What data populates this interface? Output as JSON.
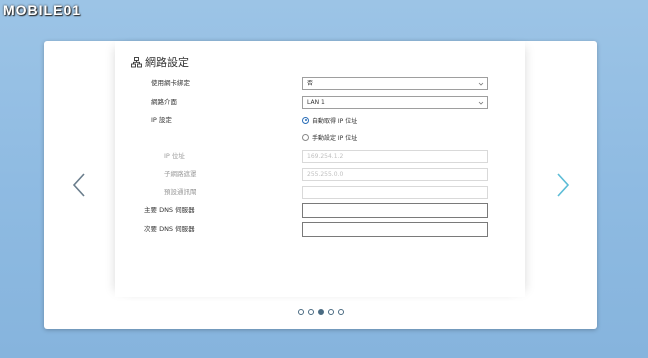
{
  "watermark": "MOBILE01",
  "page": {
    "title": "網路設定",
    "title_icon": "network-icon"
  },
  "form": {
    "bind_nic": {
      "label": "使用網卡綁定",
      "value": "否"
    },
    "interface": {
      "label": "網路介面",
      "value": "LAN 1"
    },
    "ip_setting": {
      "label": "IP 設定",
      "options": [
        {
          "label": "自動取得 IP 位址",
          "selected": true
        },
        {
          "label": "手動設定 IP 位址",
          "selected": false
        }
      ]
    },
    "ip_address": {
      "label": "IP 位址",
      "value": "169.254.1.2"
    },
    "subnet_mask": {
      "label": "子網路遮罩",
      "value": "255.255.0.0"
    },
    "gateway": {
      "label": "預設通訊閘",
      "value": ""
    },
    "primary_dns": {
      "label": "主要 DNS 伺服器",
      "value": ""
    },
    "secondary_dns": {
      "label": "次要 DNS 伺服器",
      "value": ""
    }
  },
  "navigation": {
    "prev_icon": "chevron-left-icon",
    "next_icon": "chevron-right-icon",
    "page_count": 5,
    "active_page": 3
  },
  "colors": {
    "background": "#8fbbe2",
    "accent": "#2c6fb8",
    "next_arrow": "#5bbcd6",
    "prev_arrow": "#6a7d8c"
  }
}
